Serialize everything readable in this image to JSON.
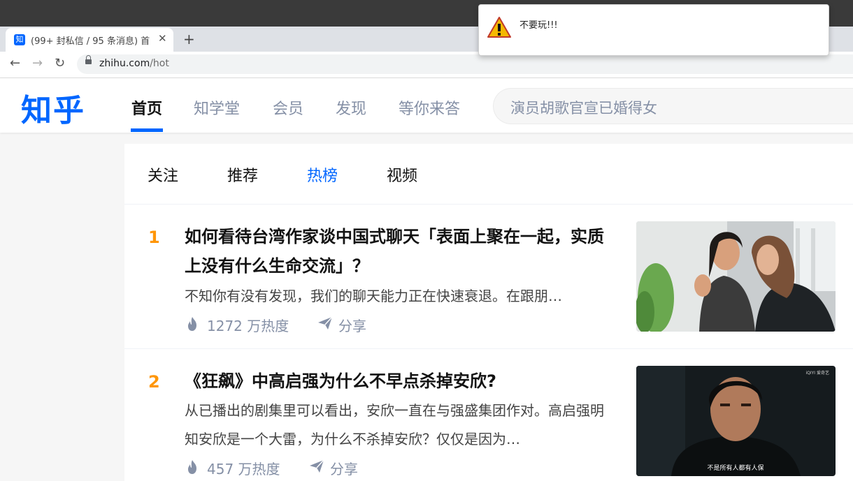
{
  "browser": {
    "tab_favicon": "知",
    "tab_title": "(99+ 封私信 / 95 条消息) 首",
    "tab_close": "✕",
    "new_tab": "+",
    "back": "←",
    "forward": "→",
    "reload": "↻",
    "url_domain": "zhihu.com",
    "url_path": "/hot"
  },
  "header": {
    "logo": "知乎",
    "nav": [
      "首页",
      "知学堂",
      "会员",
      "发现",
      "等你来答"
    ],
    "search_placeholder": "演员胡歌官宣已婚得女"
  },
  "feed": {
    "tabs": [
      "关注",
      "推荐",
      "热榜",
      "视频"
    ],
    "active_tab": "热榜",
    "items": [
      {
        "rank": "1",
        "title": "如何看待台湾作家谈中国式聊天「表面上聚在一起，实质上没有什么生命交流」？",
        "excerpt": "不知你有没有发现，我们的聊天能力正在快速衰退。在跟朋…",
        "heat": "1272 万热度",
        "share": "分享"
      },
      {
        "rank": "2",
        "title": "《狂飙》中高启强为什么不早点杀掉安欣?",
        "excerpt": "从已播出的剧集里可以看出，安欣一直在与强盛集团作对。高启强明知安欣是一个大雷，为什么不杀掉安欣？仅仅是因为…",
        "heat": "457 万热度",
        "share": "分享",
        "thumb_logo": "iQIYI 爱奇艺",
        "thumb_subtitle": "不是所有人都有人保"
      }
    ]
  },
  "alert": {
    "message": "不要玩!!!",
    "icon": "warning-icon"
  },
  "colors": {
    "brand": "#0066ff",
    "rank": "#ff9607",
    "meta": "#8590a6"
  }
}
